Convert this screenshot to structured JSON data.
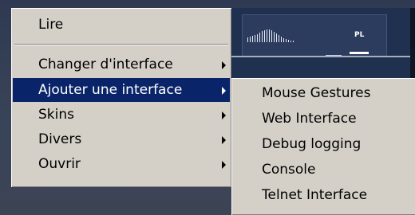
{
  "main_menu": {
    "items": [
      {
        "label": "Lire",
        "has_submenu": false
      },
      {
        "label": "Changer d'interface",
        "has_submenu": true
      },
      {
        "label": "Ajouter une interface",
        "has_submenu": true,
        "selected": true
      },
      {
        "label": "Skins",
        "has_submenu": true
      },
      {
        "label": "Divers",
        "has_submenu": true
      },
      {
        "label": "Ouvrir",
        "has_submenu": true
      }
    ]
  },
  "submenu": {
    "items": [
      {
        "label": "Mouse Gestures"
      },
      {
        "label": "Web Interface"
      },
      {
        "label": "Debug logging"
      },
      {
        "label": "Console"
      },
      {
        "label": "Telnet Interface"
      }
    ]
  },
  "player": {
    "playlist_label": "PL"
  },
  "colors": {
    "menu_bg": "#d4d0c8",
    "highlight": "#0a246a",
    "player_panel": "#20304f"
  }
}
